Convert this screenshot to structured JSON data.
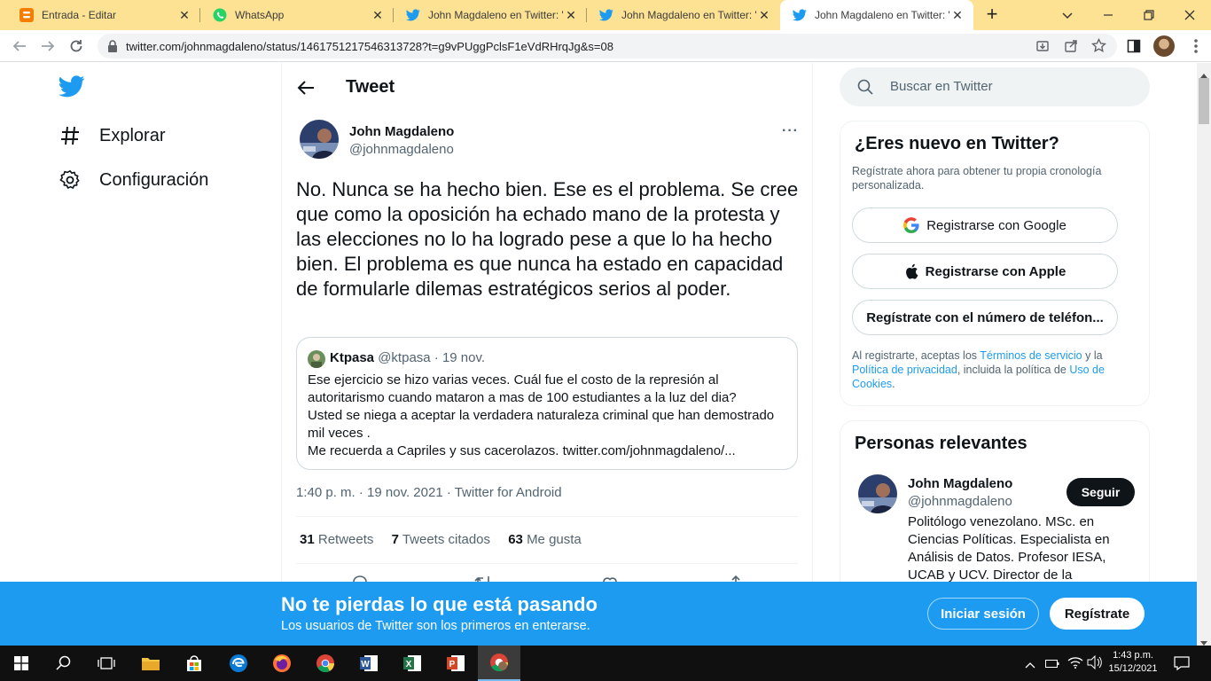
{
  "browser": {
    "tabs": [
      {
        "title": "Entrada - Editar"
      },
      {
        "title": "WhatsApp"
      },
      {
        "title": "John Magdaleno en Twitter: \""
      },
      {
        "title": "John Magdaleno en Twitter: \""
      },
      {
        "title": "John Magdaleno en Twitter: \""
      }
    ],
    "url": "twitter.com/johnmagdaleno/status/1461751217546313728?t=g9vPUggPclsF1eVdRHrqJg&s=08"
  },
  "nav": {
    "explore": "Explorar",
    "settings": "Configuración"
  },
  "header": {
    "title": "Tweet"
  },
  "tweet": {
    "name": "John Magdaleno",
    "handle": "@johnmagdaleno",
    "more": "···",
    "text": "No. Nunca se ha hecho bien. Ese es el problema. Se cree que como la oposición ha echado mano de la protesta y las elecciones no lo ha logrado pese a que lo ha hecho bien. El problema es que nunca ha estado en capacidad de formularle dilemas estratégicos serios al poder.",
    "quote": {
      "name": "Ktpasa",
      "handle": "@ktpasa",
      "date": "· 19 nov.",
      "lines": [
        "Ese ejercicio se hizo varias veces. Cuál fue el costo de la represión al",
        "autoritarismo cuando mataron a mas de 100 estudiantes a la luz del dia?",
        "Usted se niega a aceptar la verdadera naturaleza criminal que han demostrado",
        "mil veces .",
        "Me recuerda a Capriles y sus cacerolazos. twitter.com/johnmagdaleno/..."
      ]
    },
    "meta": "1:40 p. m. · 19 nov. 2021 · Twitter for Android",
    "stats": {
      "retweets_count": "31",
      "retweets_label": "Retweets",
      "quotes_count": "7",
      "quotes_label": "Tweets citados",
      "likes_count": "63",
      "likes_label": "Me gusta"
    }
  },
  "search": {
    "placeholder": "Buscar en Twitter"
  },
  "signup": {
    "title": "¿Eres nuevo en Twitter?",
    "subtitle": "Regístrate ahora para obtener tu propia cronología personalizada.",
    "google": "Registrarse con Google",
    "apple": "Registrarse con Apple",
    "phone": "Regístrate con el número de teléfon...",
    "legal_1": "Al registrarte, aceptas los",
    "terms": "Términos de servicio",
    "legal_2": "y la",
    "privacy": "Política de privacidad",
    "legal_3": ", incluida la política de",
    "cookies": "Uso de Cookies",
    "legal_4": "."
  },
  "relevant": {
    "title": "Personas relevantes",
    "name": "John Magdaleno",
    "handle": "@johnmagdaleno",
    "follow": "Seguir",
    "bio": "Politólogo venezolano. MSc. en Ciencias Políticas. Especialista en Análisis de Datos. Profesor IESA, UCAB y UCV. Director de la"
  },
  "banner": {
    "title": "No te pierdas lo que está pasando",
    "subtitle": "Los usuarios de Twitter son los primeros en enterarse.",
    "login": "Iniciar sesión",
    "register": "Regístrate"
  },
  "taskbar": {
    "time": "1:43 p.m.",
    "date": "15/12/2021"
  },
  "colors": {
    "twitter_blue": "#1d9bf0",
    "tab_strip": "#fde293",
    "taskbar": "#101010"
  }
}
